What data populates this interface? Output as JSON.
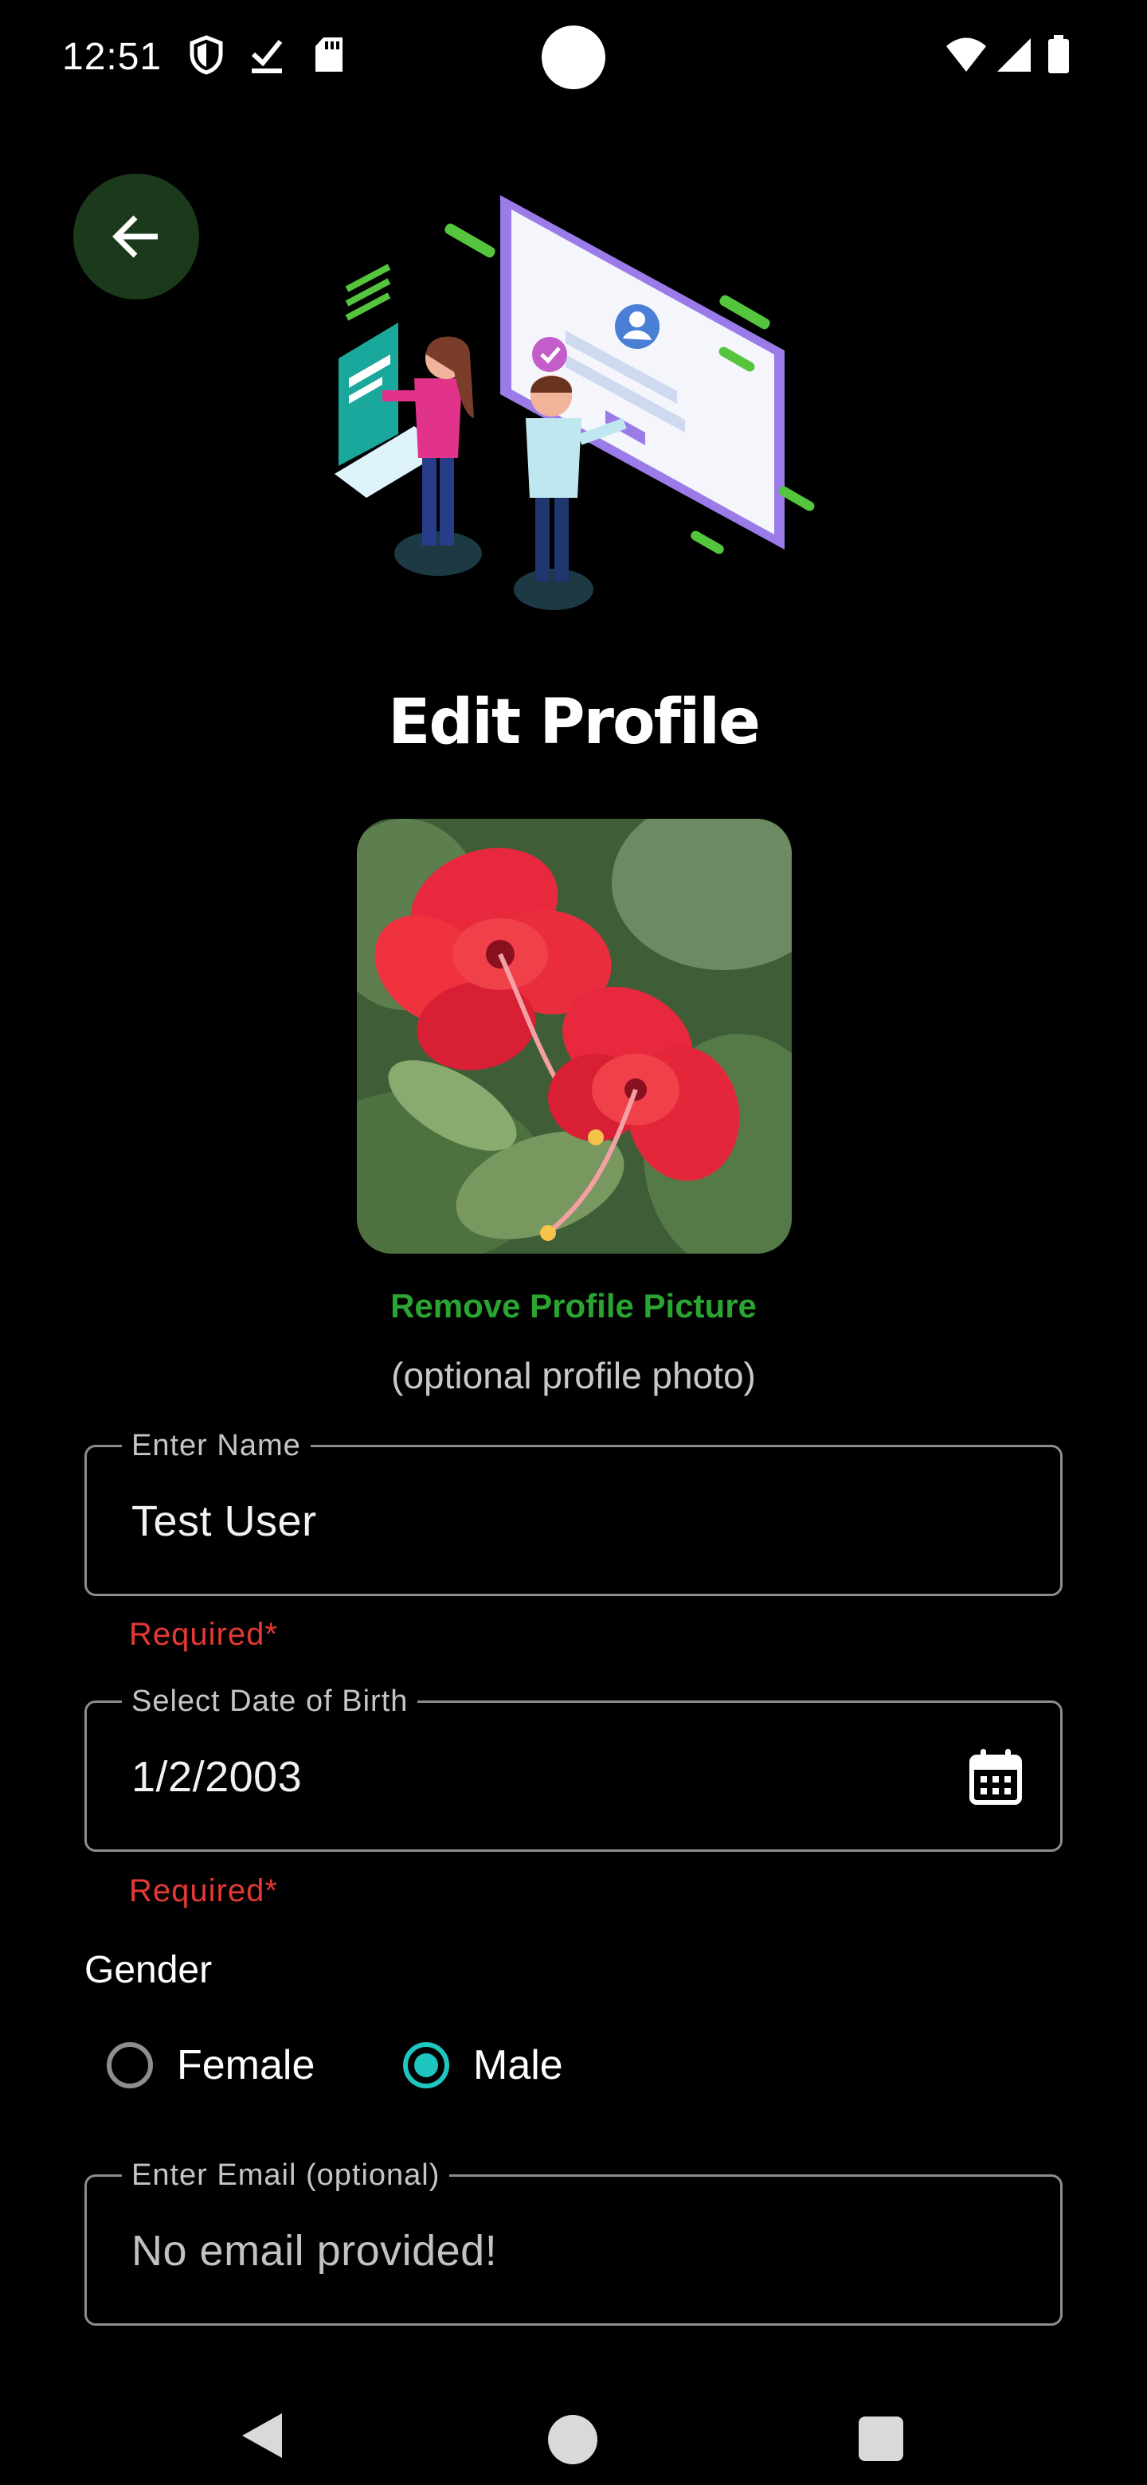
{
  "status_bar": {
    "time": "12:51",
    "icons_left": [
      "shield-icon",
      "download-done-icon",
      "sd-card-icon"
    ],
    "icons_right": [
      "wifi-icon",
      "cell-signal-icon",
      "battery-icon"
    ]
  },
  "header": {
    "back_icon": "arrow-back-icon",
    "title": "Edit Profile"
  },
  "profile_photo": {
    "subject": "red-hibiscus-flower"
  },
  "photo_actions": {
    "remove_label": "Remove Profile Picture",
    "hint": "(optional profile photo)",
    "remove_color": "#2aa531"
  },
  "form": {
    "name": {
      "label": "Enter Name",
      "value": "Test User",
      "error": "Required*"
    },
    "dob": {
      "label": "Select Date of Birth",
      "value": "1/2/2003",
      "error": "Required*",
      "icon": "calendar-icon"
    },
    "gender": {
      "label": "Gender",
      "options": [
        {
          "label": "Female",
          "selected": false
        },
        {
          "label": "Male",
          "selected": true
        }
      ],
      "accent_color": "#1fc6c0"
    },
    "email": {
      "label": "Enter Email (optional)",
      "value": "No email provided!"
    }
  },
  "nav_bar": {
    "buttons": [
      "nav-back-icon",
      "nav-home-icon",
      "nav-recents-icon"
    ]
  },
  "colors": {
    "background": "#000000",
    "error": "#e53935",
    "field_border": "#8d8d8d",
    "back_button_bg": "#1b3a1c"
  }
}
